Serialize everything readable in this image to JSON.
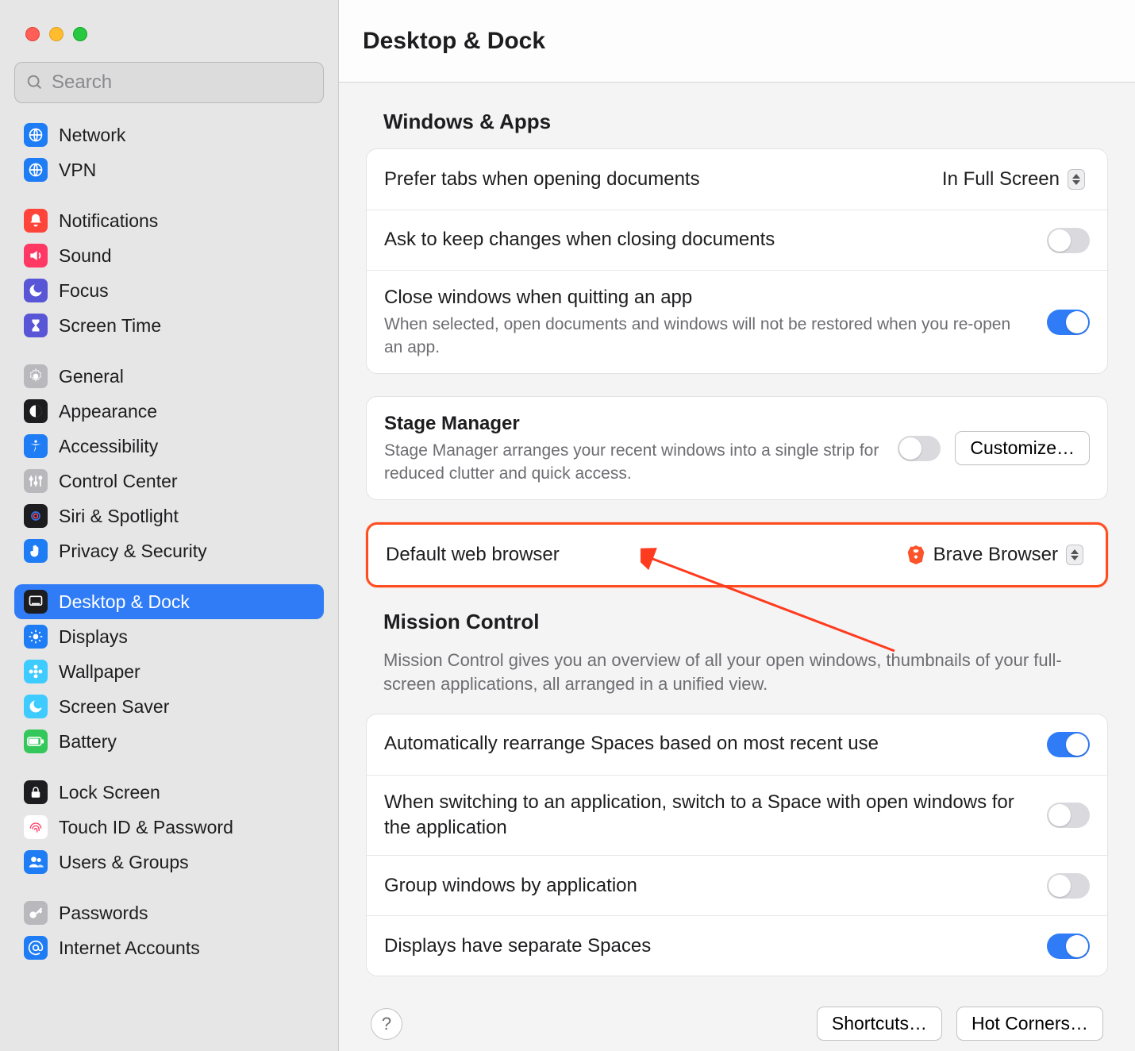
{
  "window": {
    "title": "Desktop & Dock"
  },
  "search": {
    "placeholder": "Search"
  },
  "sidebar": {
    "groups": [
      {
        "items": [
          {
            "label": "Network",
            "icon": "globe",
            "bg": "#1e7cf4",
            "fg": "#fff"
          },
          {
            "label": "VPN",
            "icon": "globe",
            "bg": "#1e7cf4",
            "fg": "#fff"
          }
        ]
      },
      {
        "items": [
          {
            "label": "Notifications",
            "icon": "bell",
            "bg": "#ff453a",
            "fg": "#fff"
          },
          {
            "label": "Sound",
            "icon": "speaker",
            "bg": "#ff3864",
            "fg": "#fff"
          },
          {
            "label": "Focus",
            "icon": "moon",
            "bg": "#5856d6",
            "fg": "#fff"
          },
          {
            "label": "Screen Time",
            "icon": "hourglass",
            "bg": "#5856d6",
            "fg": "#fff"
          }
        ]
      },
      {
        "items": [
          {
            "label": "General",
            "icon": "gear",
            "bg": "#b9b9bd",
            "fg": "#fff"
          },
          {
            "label": "Appearance",
            "icon": "appearance",
            "bg": "#1d1d1f",
            "fg": "#fff"
          },
          {
            "label": "Accessibility",
            "icon": "accessibility",
            "bg": "#1e7cf4",
            "fg": "#fff"
          },
          {
            "label": "Control Center",
            "icon": "sliders",
            "bg": "#b9b9bd",
            "fg": "#fff"
          },
          {
            "label": "Siri & Spotlight",
            "icon": "siri",
            "bg": "#1d1d1f",
            "fg": "#fff"
          },
          {
            "label": "Privacy & Security",
            "icon": "hand",
            "bg": "#1e7cf4",
            "fg": "#fff"
          }
        ]
      },
      {
        "items": [
          {
            "label": "Desktop & Dock",
            "icon": "dock",
            "bg": "#1d1d1f",
            "fg": "#fff",
            "active": true
          },
          {
            "label": "Displays",
            "icon": "sun",
            "bg": "#1e7cf4",
            "fg": "#fff"
          },
          {
            "label": "Wallpaper",
            "icon": "flower",
            "bg": "#3ecbff",
            "fg": "#fff"
          },
          {
            "label": "Screen Saver",
            "icon": "moon2",
            "bg": "#3ecbff",
            "fg": "#fff"
          },
          {
            "label": "Battery",
            "icon": "battery",
            "bg": "#34c759",
            "fg": "#fff"
          }
        ]
      },
      {
        "items": [
          {
            "label": "Lock Screen",
            "icon": "lock",
            "bg": "#1d1d1f",
            "fg": "#fff"
          },
          {
            "label": "Touch ID & Password",
            "icon": "fingerprint",
            "bg": "#ffffff",
            "fg": "#ff3864"
          },
          {
            "label": "Users & Groups",
            "icon": "users",
            "bg": "#1e7cf4",
            "fg": "#fff"
          }
        ]
      },
      {
        "items": [
          {
            "label": "Passwords",
            "icon": "key",
            "bg": "#b9b9bd",
            "fg": "#fff"
          },
          {
            "label": "Internet Accounts",
            "icon": "at",
            "bg": "#1e7cf4",
            "fg": "#fff"
          }
        ]
      }
    ]
  },
  "sections": {
    "windows_apps": {
      "header": "Windows & Apps",
      "rows": {
        "prefer_tabs": {
          "label": "Prefer tabs when opening documents",
          "value": "In Full Screen"
        },
        "ask_keep": {
          "label": "Ask to keep changes when closing documents",
          "on": false
        },
        "close_quit": {
          "label": "Close windows when quitting an app",
          "desc": "When selected, open documents and windows will not be restored when you re-open an app.",
          "on": true
        }
      }
    },
    "stage_manager": {
      "label": "Stage Manager",
      "desc": "Stage Manager arranges your recent windows into a single strip for reduced clutter and quick access.",
      "on": false,
      "customize_label": "Customize…"
    },
    "default_browser": {
      "label": "Default web browser",
      "value": "Brave Browser"
    },
    "mission_control": {
      "header": "Mission Control",
      "desc": "Mission Control gives you an overview of all your open windows, thumbnails of your full-screen applications, all arranged in a unified view.",
      "rows": {
        "auto_rearrange": {
          "label": "Automatically rearrange Spaces based on most recent use",
          "on": true
        },
        "switch_space": {
          "label": "When switching to an application, switch to a Space with open windows for the application",
          "on": false
        },
        "group_windows": {
          "label": "Group windows by application",
          "on": false
        },
        "separate_spaces": {
          "label": "Displays have separate Spaces",
          "on": true
        }
      }
    },
    "footer": {
      "help": "?",
      "shortcuts": "Shortcuts…",
      "hot_corners": "Hot Corners…"
    }
  }
}
